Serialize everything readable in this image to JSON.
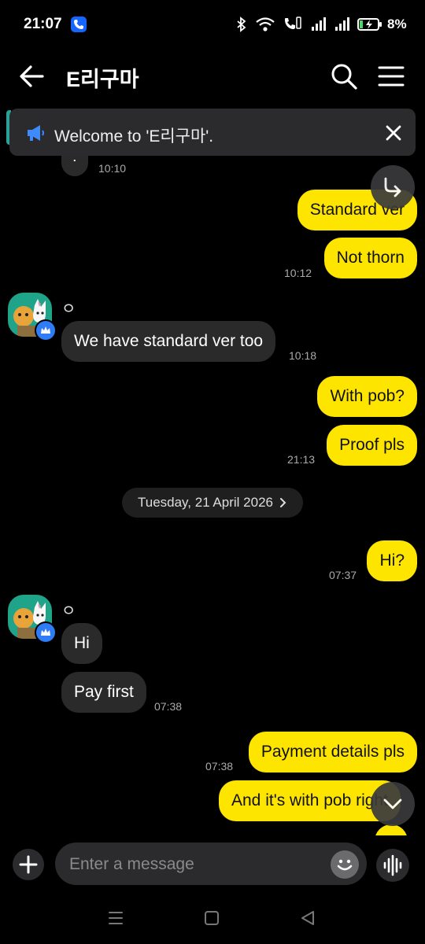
{
  "status_bar": {
    "time": "21:07",
    "battery": "8%"
  },
  "header": {
    "title": "E리구마"
  },
  "banner": {
    "text": "Welcome to 'E리구마'."
  },
  "partial_message": {
    "text": ":",
    "time": "10:10"
  },
  "messages_block1": {
    "m1": "Standard ver",
    "m2": "Not thorn",
    "t1": "10:12",
    "sender": "ㅇ",
    "m3": "We have standard ver too",
    "t2": "10:18",
    "m4": "With pob?",
    "m5": "Proof pls",
    "t3": "21:13"
  },
  "date_divider": "Tuesday, 21 April 2026",
  "messages_block2": {
    "m1": "Hi?",
    "t1": "07:37",
    "sender": "ㅇ",
    "m2": "Hi",
    "m3": "Pay first",
    "t2": "07:38",
    "m4": "Payment details pls",
    "t3": "07:38",
    "m5": "And it's with pob right"
  },
  "input": {
    "placeholder": "Enter a message"
  },
  "colors": {
    "mine_bubble": "#fee500",
    "theirs_bubble": "#2a2a2a",
    "background": "#000000"
  }
}
